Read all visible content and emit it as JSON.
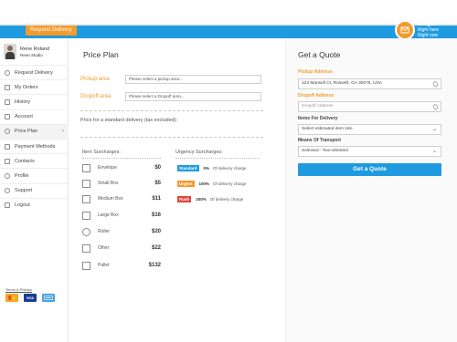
{
  "header": {
    "request_delivery_label": "Request Delivery",
    "logo_brand": "Bringoz",
    "logo_tagline_1": "Right here",
    "logo_tagline_2": "Right now"
  },
  "profile": {
    "name": "Rene Roland",
    "subtitle": "Rene Studio"
  },
  "sidebar": {
    "items": [
      {
        "label": "Request Delivery",
        "icon": "delivery-icon"
      },
      {
        "label": "My Orders",
        "icon": "orders-icon"
      },
      {
        "label": "History",
        "icon": "history-icon"
      },
      {
        "label": "Account",
        "icon": "account-icon"
      },
      {
        "label": "Price Plan",
        "icon": "price-icon",
        "active": true,
        "chevron": "›"
      },
      {
        "label": "Payment Methods",
        "icon": "payment-icon"
      },
      {
        "label": "Contacts",
        "icon": "contacts-icon"
      },
      {
        "label": "Profile",
        "icon": "profile-icon"
      },
      {
        "label": "Support",
        "icon": "support-icon"
      },
      {
        "label": "Logout",
        "icon": "logout-icon"
      }
    ],
    "terms_label": "Terms & Privacy",
    "cards": [
      "MasterCard",
      "VISA",
      "AMEX"
    ]
  },
  "price_plan": {
    "title": "Price Plan",
    "pickup_label": "Pickup area",
    "pickup_placeholder": "Please select a pickup area...",
    "dropoff_label": "Dropoff area",
    "dropoff_placeholder": "Please select a Dropoff area...",
    "caption": "Price for a standard delivery (tax excluded):",
    "item_surcharges_title": "Item Surcharges:",
    "urgency_surcharges_title": "Urgency Surcharges:",
    "items": [
      {
        "label": "Envelope",
        "price": "$0"
      },
      {
        "label": "Small Box",
        "price": "$5"
      },
      {
        "label": "Medium Box",
        "price": "$11"
      },
      {
        "label": "Large Box",
        "price": "$16"
      },
      {
        "label": "Roller",
        "price": "$20"
      },
      {
        "label": "Other",
        "price": "$22"
      },
      {
        "label": "Pallet",
        "price": "$132"
      }
    ],
    "urgency": [
      {
        "badge": "Standard",
        "pct": "0%",
        "text": "Of delivery charge",
        "color": "#1e9be0"
      },
      {
        "badge": "Urgent",
        "pct": "100%",
        "text": "Of delivery charge",
        "color": "#f39a2d"
      },
      {
        "badge": "Rush",
        "pct": "200%",
        "text": "Of delivery charge",
        "color": "#e2463a"
      }
    ]
  },
  "quote": {
    "title": "Get a Quote",
    "pickup_label": "Pickup Address",
    "pickup_value": "123 Mansell Ct, Roswell, GA 30076, USA",
    "dropoff_label": "Dropoff Address",
    "dropoff_placeholder": "Dropoff Address",
    "items_label": "Items For Delivery",
    "items_value": "Select estimated item size",
    "transport_label": "Means Of Transport",
    "transport_value": "Selected : Two-wheeled",
    "button_label": "Get a Quote"
  },
  "colors": {
    "accent_blue": "#1e9be0",
    "accent_orange": "#f39a2d",
    "rush_red": "#e2463a"
  }
}
